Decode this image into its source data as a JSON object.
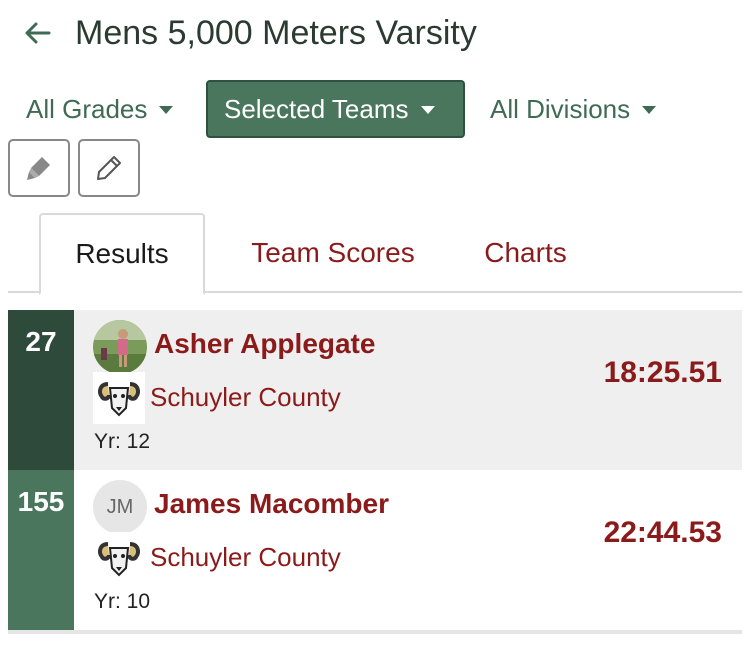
{
  "header": {
    "back_icon": "arrow-left-icon",
    "title": "Mens 5,000 Meters Varsity"
  },
  "filters": {
    "grades_label": "All Grades",
    "teams_label": "Selected Teams",
    "divisions_label": "All Divisions"
  },
  "tools": {
    "highlight_icon": "highlighter-icon",
    "edit_icon": "pencil-icon"
  },
  "tabs": [
    {
      "label": "Results",
      "active": true
    },
    {
      "label": "Team Scores",
      "active": false
    },
    {
      "label": "Charts",
      "active": false
    }
  ],
  "results": [
    {
      "place": "27",
      "name": "Asher Applegate",
      "team": "Schuyler County",
      "year": "Yr: 12",
      "time": "18:25.51",
      "avatar": "photo"
    },
    {
      "place": "155",
      "name": "James Macomber",
      "team": "Schuyler County",
      "year": "Yr: 10",
      "time": "22:44.53",
      "avatar": "JM"
    }
  ],
  "colors": {
    "accent": "#4a765e",
    "dark_accent": "#2e4a3b",
    "link": "#8b1a1a",
    "row_highlight": "#efefef"
  }
}
